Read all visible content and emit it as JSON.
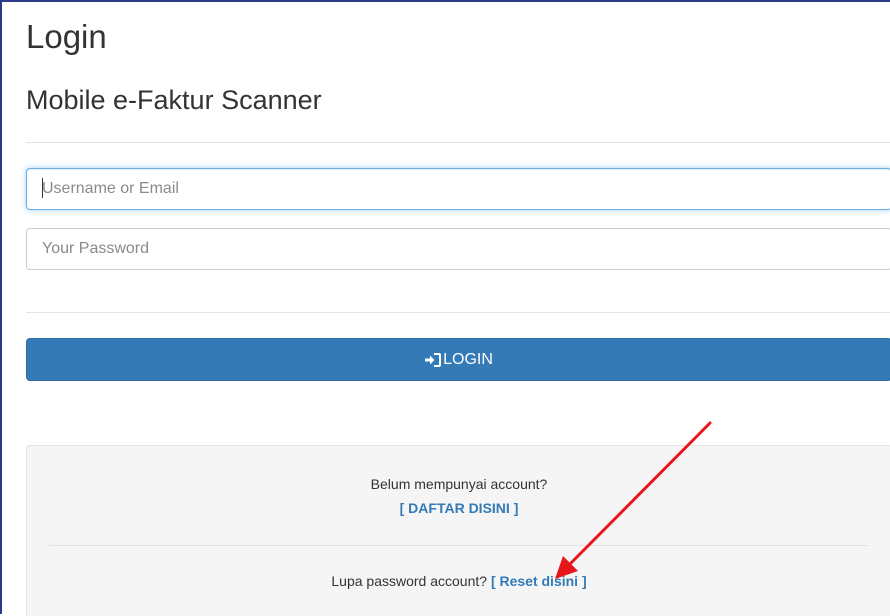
{
  "header": {
    "title": "Login",
    "subtitle": "Mobile e-Faktur Scanner"
  },
  "form": {
    "username_placeholder": "Username or Email",
    "password_placeholder": "Your Password",
    "login_label": "LOGIN",
    "login_icon": "sign-in-icon"
  },
  "register": {
    "prompt": "Belum mempunyai account?",
    "link_label": "[ DAFTAR DISINI ]"
  },
  "reset": {
    "prompt": "Lupa password account?",
    "link_label": "[ Reset disini ]"
  },
  "annotation": {
    "arrow_color": "#e8161b"
  },
  "colors": {
    "primary": "#337ab7",
    "panel_bg": "#f5f5f5",
    "focus": "#66afe9"
  }
}
